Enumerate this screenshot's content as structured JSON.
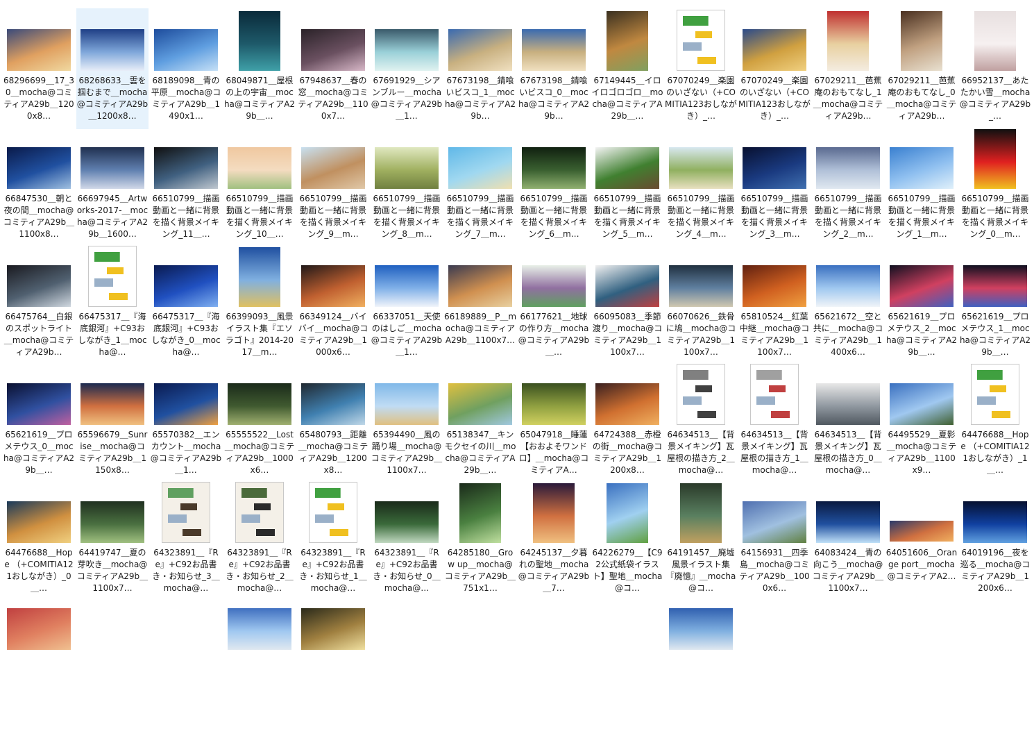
{
  "items": [
    {
      "name": "68296699＿17_30＿mocha@コミティアA29b＿1200x8…",
      "thumb": "landscape",
      "colors": [
        "#3a4a7a",
        "#e0a060",
        "#f0d8a0"
      ]
    },
    {
      "name": "68268633＿雲を掴むまで＿mocha@コミティアA29b＿1200x8…",
      "thumb": "landscape",
      "colors": [
        "#1f3f86",
        "#7fa7da",
        "#e8eef8"
      ],
      "selected": true
    },
    {
      "name": "68189098＿青の平原＿mocha@コミティアA29b＿1490x1…",
      "thumb": "landscape",
      "colors": [
        "#1d4c9c",
        "#5f9ee0",
        "#c6e0f6"
      ]
    },
    {
      "name": "68049871＿屋根の上の宇宙＿mocha@コミティアA29b＿…",
      "thumb": "portrait",
      "colors": [
        "#0a2a3a",
        "#1e5a6a",
        "#3fa0a8"
      ]
    },
    {
      "name": "67948637＿春の窓＿mocha@コミティアA29b＿1100x7…",
      "thumb": "landscape",
      "colors": [
        "#2a2228",
        "#6a5060",
        "#d8b8c8"
      ]
    },
    {
      "name": "67691929＿シアンブルー＿mocha@コミティアA29b＿1…",
      "thumb": "landscape",
      "colors": [
        "#3a5a6a",
        "#9ad0d8",
        "#e0f2f0"
      ]
    },
    {
      "name": "67673198＿錆喰いビスコ_1＿mocha@コミティアA29b…",
      "thumb": "landscape",
      "colors": [
        "#3a6ab0",
        "#c8b080",
        "#f0e0c0"
      ]
    },
    {
      "name": "67673198＿錆喰いビスコ_0＿mocha@コミティアA29b…",
      "thumb": "landscape",
      "colors": [
        "#3a6ab0",
        "#c8b080",
        "#f0e0c0"
      ]
    },
    {
      "name": "67149445＿イロイロゴロゴロ＿mocha@コミティアA29b＿…",
      "thumb": "portrait",
      "colors": [
        "#3a3020",
        "#c08840",
        "#80a060"
      ]
    },
    {
      "name": "67070249＿楽園のいざない（+COMITIA123おしながき）_…",
      "thumb": "doc",
      "colors": [
        "#ffffff",
        "#40a040",
        "#f0c020"
      ]
    },
    {
      "name": "67070249＿楽園のいざない（+COMITIA123おしながき）_…",
      "thumb": "landscape",
      "colors": [
        "#2a4a8a",
        "#d0a040",
        "#f0d080"
      ]
    },
    {
      "name": "67029211＿芭蕉庵のおもてなし_1＿mocha@コミティアA29b…",
      "thumb": "portrait",
      "colors": [
        "#c03030",
        "#e8d0a0",
        "#f4ece0"
      ]
    },
    {
      "name": "67029211＿芭蕉庵のおもてなし_0＿mocha@コミティアA29b…",
      "thumb": "portrait",
      "colors": [
        "#4a3020",
        "#c0a080",
        "#e8e0d0"
      ]
    },
    {
      "name": "66952137＿あたたかい雪＿mocha@コミティアA29b_…",
      "thumb": "portrait",
      "colors": [
        "#e8e0e0",
        "#f6f0f0",
        "#c0a0a0"
      ]
    },
    {
      "name": "66847530＿朝と夜の間＿mocha@コミティアA29b＿1100x8…",
      "thumb": "landscape",
      "colors": [
        "#0a1a4a",
        "#2050a0",
        "#a0c0e0"
      ]
    },
    {
      "name": "66697945＿Artworks-2017-＿mocha@コミティアA29b＿1600…",
      "thumb": "landscape",
      "colors": [
        "#203050",
        "#6080b0",
        "#d0d8e8"
      ]
    },
    {
      "name": "66510799＿描画動画と一緒に背景を描く背景メイキング_11＿…",
      "thumb": "landscape",
      "colors": [
        "#101010",
        "#406080",
        "#c0c8d0"
      ]
    },
    {
      "name": "66510799＿描画動画と一緒に背景を描く背景メイキング_10＿…",
      "thumb": "landscape",
      "colors": [
        "#f0c8a0",
        "#f4dcc0",
        "#a0c080"
      ]
    },
    {
      "name": "66510799＿描画動画と一緒に背景を描く背景メイキング_9＿m…",
      "thumb": "landscape",
      "colors": [
        "#c8e0f0",
        "#c09060",
        "#e0c8a8"
      ]
    },
    {
      "name": "66510799＿描画動画と一緒に背景を描く背景メイキング_8＿m…",
      "thumb": "landscape",
      "colors": [
        "#e0e8c0",
        "#a0b060",
        "#708040"
      ]
    },
    {
      "name": "66510799＿描画動画と一緒に背景を描く背景メイキング_7＿m…",
      "thumb": "landscape",
      "colors": [
        "#60b8e8",
        "#a0d8f0",
        "#f0e0b0"
      ]
    },
    {
      "name": "66510799＿描画動画と一緒に背景を描く背景メイキング_6＿m…",
      "thumb": "landscape",
      "colors": [
        "#102010",
        "#3a6030",
        "#90b070"
      ]
    },
    {
      "name": "66510799＿描画動画と一緒に背景を描く背景メイキング_5＿m…",
      "thumb": "landscape",
      "colors": [
        "#f4f4f4",
        "#408030",
        "#6a4a30"
      ]
    },
    {
      "name": "66510799＿描画動画と一緒に背景を描く背景メイキング_4＿m…",
      "thumb": "landscape",
      "colors": [
        "#d8e8f0",
        "#90b060",
        "#e8e0c0"
      ]
    },
    {
      "name": "66510799＿描画動画と一緒に背景を描く背景メイキング_3＿m…",
      "thumb": "landscape",
      "colors": [
        "#081030",
        "#1a3a80",
        "#4070b0"
      ]
    },
    {
      "name": "66510799＿描画動画と一緒に背景を描く背景メイキング_2＿m…",
      "thumb": "landscape",
      "colors": [
        "#5a6a90",
        "#b0c0d8",
        "#e0e8f0"
      ]
    },
    {
      "name": "66510799＿描画動画と一緒に背景を描く背景メイキング_1＿m…",
      "thumb": "landscape",
      "colors": [
        "#3a80d0",
        "#90c0f0",
        "#e0f0fa"
      ]
    },
    {
      "name": "66510799＿描画動画と一緒に背景を描く背景メイキング_0＿m…",
      "thumb": "portrait",
      "colors": [
        "#101010",
        "#e02020",
        "#f0c020"
      ]
    },
    {
      "name": "66475764＿白銀のスポットライト＿mocha@コミティアA29b…",
      "thumb": "landscape",
      "colors": [
        "#1a1a20",
        "#506070",
        "#d0d8e0"
      ]
    },
    {
      "name": "66475317＿『海底銀河』+C93おしながき_1＿mocha@…",
      "thumb": "doc",
      "colors": [
        "#ffffff",
        "#40a040",
        "#f0c020"
      ]
    },
    {
      "name": "66475317＿『海底銀河』+C93おしながき_0＿mocha@…",
      "thumb": "landscape",
      "colors": [
        "#0a1a50",
        "#2050c0",
        "#80b0f0"
      ]
    },
    {
      "name": "66399093＿風景イラスト集『エソラゴト』2014-2017＿m…",
      "thumb": "portrait",
      "colors": [
        "#2050a0",
        "#80b0e0",
        "#e0c060"
      ]
    },
    {
      "name": "66349124＿バイバイ＿mocha@コミティアA29b＿1000x6…",
      "thumb": "landscape",
      "colors": [
        "#201818",
        "#c06030",
        "#f0b060"
      ]
    },
    {
      "name": "66337051＿天使のはしご＿mocha@コミティアA29b＿1…",
      "thumb": "landscape",
      "colors": [
        "#2060c0",
        "#80b0e8",
        "#f0f4fa"
      ]
    },
    {
      "name": "66189889＿P＿mocha@コミティアA29b＿1100x7…",
      "thumb": "landscape",
      "colors": [
        "#3a3a50",
        "#d09050",
        "#e8d0a0"
      ]
    },
    {
      "name": "66177621＿地球の作り方＿mocha@コミティアA29b＿…",
      "thumb": "landscape",
      "colors": [
        "#e8f0e8",
        "#9070a0",
        "#60a060"
      ]
    },
    {
      "name": "66095083＿季節渡り＿mocha@コミティアA29b＿1100x7…",
      "thumb": "landscape",
      "colors": [
        "#f0f0f0",
        "#306080",
        "#c04040"
      ]
    },
    {
      "name": "66070626＿鉄骨に鳩＿mocha@コミティアA29b＿1100x7…",
      "thumb": "landscape",
      "colors": [
        "#203040",
        "#6080a0",
        "#d0c8b0"
      ]
    },
    {
      "name": "65810524＿紅葉中継＿mocha@コミティアA29b＿1100x7…",
      "thumb": "landscape",
      "colors": [
        "#602010",
        "#d06020",
        "#f0a040"
      ]
    },
    {
      "name": "65621672＿空と共に＿mocha@コミティアA29b＿1400x6…",
      "thumb": "landscape",
      "colors": [
        "#3a70c0",
        "#a0c8f0",
        "#f0f4f8"
      ]
    },
    {
      "name": "65621619＿プロメテウス_2＿mocha@コミティアA29b＿…",
      "thumb": "landscape",
      "colors": [
        "#101020",
        "#d04060",
        "#4060c0"
      ]
    },
    {
      "name": "65621619＿プロメテウス_1＿mocha@コミティアA29b＿…",
      "thumb": "landscape",
      "colors": [
        "#101020",
        "#d04060",
        "#4060c0"
      ]
    },
    {
      "name": "65621619＿プロメテウス_0＿mocha@コミティアA29b＿…",
      "thumb": "landscape",
      "colors": [
        "#0a1030",
        "#3050a0",
        "#c060a0"
      ]
    },
    {
      "name": "65596679＿Sunrise＿mocha@コミティアA29b＿1150x8…",
      "thumb": "landscape",
      "colors": [
        "#1a2a50",
        "#d07040",
        "#f0c080"
      ]
    },
    {
      "name": "65570382＿エンカウント＿mocha@コミティアA29b＿1…",
      "thumb": "landscape",
      "colors": [
        "#0a1a50",
        "#2050a0",
        "#f0a040"
      ]
    },
    {
      "name": "65555522＿Lost＿mocha@コミティアA29b＿1000x6…",
      "thumb": "landscape",
      "colors": [
        "#1a2a1a",
        "#405a30",
        "#a0b070"
      ]
    },
    {
      "name": "65480793＿距離＿mocha@コミティアA29b＿1200x8…",
      "thumb": "landscape",
      "colors": [
        "#202830",
        "#4080b0",
        "#c0d8e8"
      ]
    },
    {
      "name": "65394490＿風の踊り場＿mocha@コミティアA29b＿1100x7…",
      "thumb": "landscape",
      "colors": [
        "#80b8e8",
        "#c0dcf4",
        "#e0c080"
      ]
    },
    {
      "name": "65138347＿キンモクセイの川＿mocha@コミティアA29b＿…",
      "thumb": "landscape",
      "colors": [
        "#e0c040",
        "#70a060",
        "#a0c8e0"
      ]
    },
    {
      "name": "65047918＿睡蓮【おおよそワンドロ】＿mocha@コミティアA…",
      "thumb": "landscape",
      "colors": [
        "#3a5020",
        "#90a040",
        "#d0d060"
      ]
    },
    {
      "name": "64724388＿赤橙の街＿mocha@コミティアA29b＿1200x8…",
      "thumb": "landscape",
      "colors": [
        "#3a2020",
        "#d07030",
        "#f0b060"
      ]
    },
    {
      "name": "64634513＿【背景メイキング】瓦屋根の描き方_2＿mocha@…",
      "thumb": "doc",
      "colors": [
        "#ffffff",
        "#808080",
        "#404040"
      ]
    },
    {
      "name": "64634513＿【背景メイキング】瓦屋根の描き方_1＿mocha@…",
      "thumb": "doc",
      "colors": [
        "#ffffff",
        "#a0a0a0",
        "#c04040"
      ]
    },
    {
      "name": "64634513＿【背景メイキング】瓦屋根の描き方_0＿mocha@…",
      "thumb": "landscape",
      "colors": [
        "#e8e8e8",
        "#9098a0",
        "#505860"
      ]
    },
    {
      "name": "64495529＿夏影＿mocha@コミティアA29b＿1100x9…",
      "thumb": "landscape",
      "colors": [
        "#3a70c0",
        "#a0c8f0",
        "#406030"
      ]
    },
    {
      "name": "64476688＿Hope （+COMITIA121おしながき）_1＿…",
      "thumb": "doc",
      "colors": [
        "#ffffff",
        "#40a040",
        "#f0c020"
      ]
    },
    {
      "name": "64476688＿Hope （+COMITIA121おしながき）_0＿…",
      "thumb": "landscape",
      "colors": [
        "#1a3a5a",
        "#d09040",
        "#f0d080"
      ]
    },
    {
      "name": "64419747＿夏の芽吹き＿mocha@コミティアA29b＿1100x7…",
      "thumb": "landscape",
      "colors": [
        "#203020",
        "#4a7040",
        "#a0c080"
      ]
    },
    {
      "name": "64323891＿『Re』+C92お品書き・お知らせ_3＿mocha@…",
      "thumb": "doc",
      "colors": [
        "#f4f0e8",
        "#60a060",
        "#4a3a2a"
      ]
    },
    {
      "name": "64323891＿『Re』+C92お品書き・お知らせ_2＿mocha@…",
      "thumb": "doc",
      "colors": [
        "#f4f0e8",
        "#4a6a3a",
        "#2a2a2a"
      ]
    },
    {
      "name": "64323891＿『Re』+C92お品書き・お知らせ_1＿mocha@…",
      "thumb": "doc",
      "colors": [
        "#ffffff",
        "#40a040",
        "#f0c020"
      ]
    },
    {
      "name": "64323891＿『Re』+C92お品書き・お知らせ_0＿mocha@…",
      "thumb": "landscape",
      "colors": [
        "#1a2a1a",
        "#3a6a3a",
        "#c0d8c0"
      ]
    },
    {
      "name": "64285180＿Grow up＿mocha@コミティアA29b＿751x1…",
      "thumb": "portrait",
      "colors": [
        "#1a2a1a",
        "#4a8040",
        "#c0e0a0"
      ]
    },
    {
      "name": "64245137＿夕暮れの聖地＿mocha@コミティアA29b＿7…",
      "thumb": "portrait",
      "colors": [
        "#2a1a3a",
        "#d07040",
        "#f0c080"
      ]
    },
    {
      "name": "64226279＿【C92公式紙袋イラスト】聖地＿mocha@コ…",
      "thumb": "portrait",
      "colors": [
        "#3a70c0",
        "#a0d0f0",
        "#60a040"
      ]
    },
    {
      "name": "64191457＿廃墟風景イラスト集『廃憶』＿mocha@コ…",
      "thumb": "portrait",
      "colors": [
        "#2a3a2a",
        "#5a8060",
        "#c0a060"
      ]
    },
    {
      "name": "64156931＿四季島＿mocha@コミティアA29b＿1000x6…",
      "thumb": "landscape",
      "colors": [
        "#5070b0",
        "#a0c0e0",
        "#608040"
      ]
    },
    {
      "name": "64083424＿青の向こう＿mocha@コミティアA29b＿1100x7…",
      "thumb": "landscape",
      "colors": [
        "#0a1a40",
        "#2050a0",
        "#c0e0f8"
      ]
    },
    {
      "name": "64051606＿Orange port＿mocha@コミティアA2…",
      "thumb": "wide",
      "colors": [
        "#2a3a6a",
        "#d07040",
        "#f0b060"
      ]
    },
    {
      "name": "64019196＿夜を巡る＿mocha@コミティアA29b＿1200x6…",
      "thumb": "landscape",
      "colors": [
        "#061030",
        "#1040a0",
        "#60a0e0"
      ]
    }
  ],
  "partial_row": [
    {
      "col": 0,
      "colors": [
        "#c04040",
        "#e08060",
        "#f0c090"
      ]
    },
    {
      "col": 3,
      "colors": [
        "#4070c0",
        "#a0c8f0",
        "#e0e8f0"
      ]
    },
    {
      "col": 4,
      "colors": [
        "#2a2a1a",
        "#a08040",
        "#f0e0a0"
      ]
    },
    {
      "col": 9,
      "colors": [
        "#3060b0",
        "#80b0e0",
        "#e0e8f0"
      ]
    }
  ]
}
